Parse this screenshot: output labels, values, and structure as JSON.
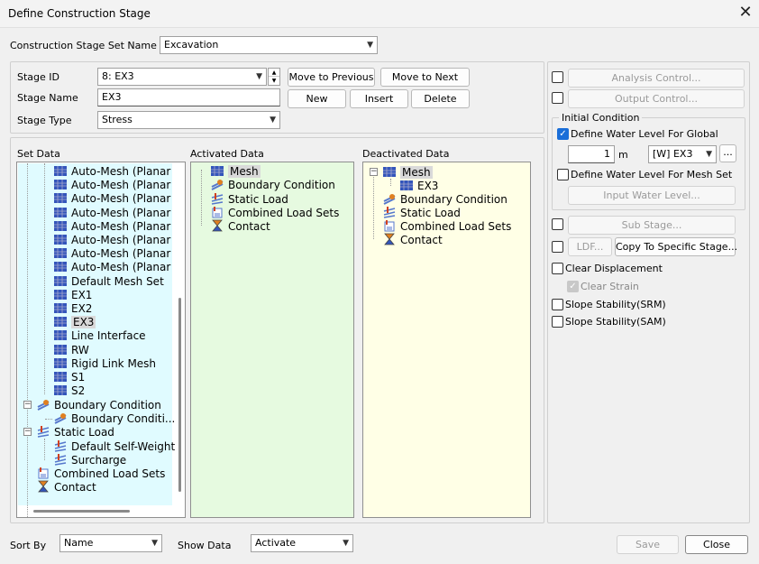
{
  "window": {
    "title": "Define Construction Stage"
  },
  "set_name": {
    "label": "Construction Stage Set Name",
    "value": "Excavation"
  },
  "stage": {
    "id_label": "Stage ID",
    "id_value": "8: EX3",
    "name_label": "Stage Name",
    "name_value": "EX3",
    "type_label": "Stage Type",
    "type_value": "Stress"
  },
  "buttons": {
    "move_prev": "Move to Previous",
    "move_next": "Move to Next",
    "new": "New",
    "insert": "Insert",
    "delete": "Delete",
    "analysis_control": "Analysis Control...",
    "output_control": "Output Control...",
    "input_water_level": "Input Water Level...",
    "sub_stage": "Sub Stage...",
    "ldf": "LDF...",
    "copy_to_stage": "Copy To Specific Stage...",
    "save": "Save",
    "close": "Close",
    "more": "..."
  },
  "panels": {
    "set_data": "Set Data",
    "activated": "Activated Data",
    "deactivated": "Deactivated Data"
  },
  "set_data_items": [
    "Auto-Mesh (Planar Area)",
    "Auto-Mesh (Planar Area)",
    "Auto-Mesh (Planar Area)",
    "Auto-Mesh (Planar Area)",
    "Auto-Mesh (Planar Area)",
    "Auto-Mesh (Planar Area)",
    "Auto-Mesh (Planar Area)",
    "Auto-Mesh (Planar Area)",
    "Default Mesh Set",
    "EX1",
    "EX2",
    "EX3",
    "Line Interface",
    "RW",
    "Rigid Link Mesh",
    "S1",
    "S2"
  ],
  "set_data_groups": {
    "boundary": "Boundary Condition",
    "boundary_child": "Boundary Conditi...",
    "static": "Static Load",
    "static_child1": "Default Self-Weight",
    "static_child2": "Surcharge",
    "combined": "Combined Load Sets",
    "contact": "Contact"
  },
  "activated_items": [
    "Mesh",
    "Boundary Condition",
    "Static Load",
    "Combined Load Sets",
    "Contact"
  ],
  "deactivated_items": {
    "mesh": "Mesh",
    "mesh_child": "EX3",
    "boundary": "Boundary Condition",
    "static": "Static Load",
    "combined": "Combined Load Sets",
    "contact": "Contact"
  },
  "initial_condition": {
    "group_label": "Initial Condition",
    "global_label": "Define Water Level For Global",
    "global_checked": true,
    "water_value": "1",
    "water_unit": "m",
    "water_set": "[W] EX3",
    "mesh_set_label": "Define Water Level For Mesh Set",
    "mesh_set_checked": false
  },
  "options": {
    "clear_displacement": "Clear Displacement",
    "clear_strain": "Clear Strain",
    "slope_srm": "Slope Stability(SRM)",
    "slope_sam": "Slope Stability(SAM)"
  },
  "bottom": {
    "sort_label": "Sort By",
    "sort_value": "Name",
    "show_label": "Show Data",
    "show_value": "Activate"
  },
  "colors": {
    "set_bg": "#e0fbff",
    "activated_bg": "#e6fae0",
    "deactivated_bg": "#ffffe6",
    "accent": "#1a6ed8"
  }
}
